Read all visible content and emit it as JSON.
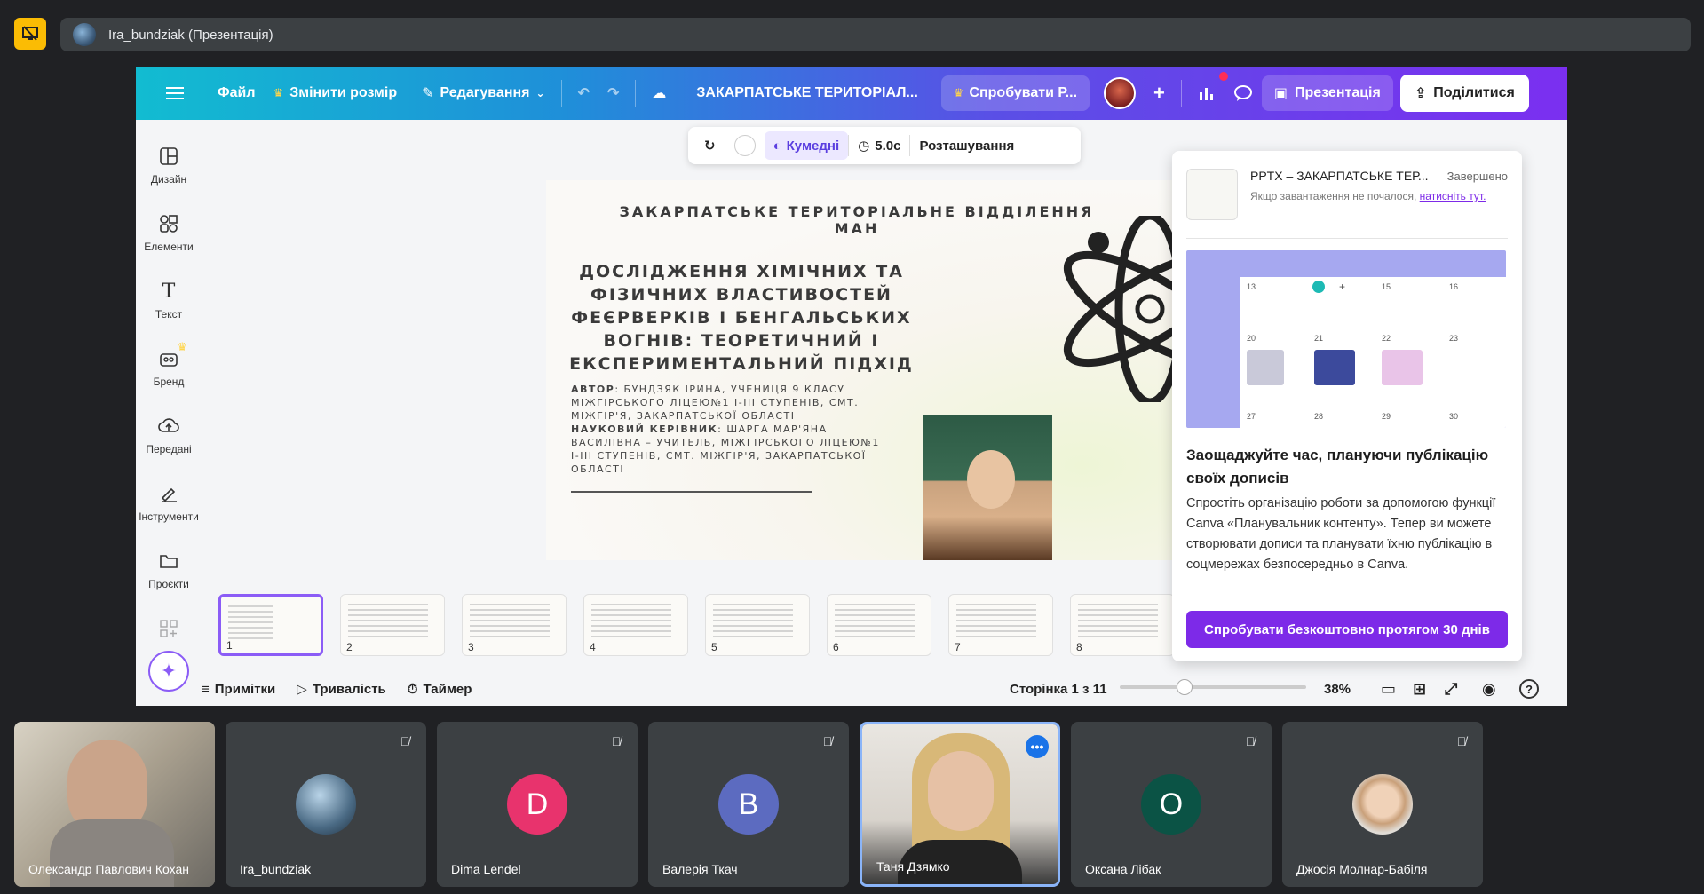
{
  "meet": {
    "presenter_label": "Ira_bundziak (Презентація)"
  },
  "canva": {
    "header": {
      "file": "Файл",
      "resize": "Змінити розмір",
      "editing": "Редагування",
      "doc_title": "ЗАКАРПАТСЬКЕ ТЕРИТОРІАЛ...",
      "try_pro": "Спробувати Р...",
      "present": "Презентація",
      "share": "Поділитися"
    },
    "sidebar": [
      {
        "label": "Дизайн",
        "icon": "design-icon"
      },
      {
        "label": "Елементи",
        "icon": "elements-icon"
      },
      {
        "label": "Текст",
        "icon": "text-icon"
      },
      {
        "label": "Бренд",
        "icon": "brand-icon"
      },
      {
        "label": "Передані",
        "icon": "uploads-icon"
      },
      {
        "label": "Інструменти",
        "icon": "tools-icon"
      },
      {
        "label": "Проєкти",
        "icon": "projects-icon"
      }
    ],
    "floating_toolbar": {
      "style": "Кумедні",
      "duration": "5.0с",
      "position": "Розташування"
    },
    "slide": {
      "header": "ЗАКАРПАТСЬКЕ ТЕРИТОРІАЛЬНЕ ВІДДІЛЕННЯ МАН",
      "title": "ДОСЛІДЖЕННЯ ХІМІЧНИХ ТА ФІЗИЧНИХ ВЛАСТИВОСТЕЙ ФЕЄРВЕРКІВ І БЕНГАЛЬСЬКИХ ВОГНІВ: ТЕОРЕТИЧНИЙ І ЕКСПЕРИМЕНТАЛЬНИЙ ПІДХІД",
      "author_label": "АВТОР",
      "author_text": ": БУНДЗЯК ІРИНА, УЧЕНИЦЯ 9 КЛАСУ МІЖГІРСЬКОГО ЛІЦЕЮ№1 І-ІІІ СТУПЕНІВ, СМТ. МІЖГІР'Я, ЗАКАРПАТСЬКОЇ ОБЛАСТІ",
      "advisor_label": "НАУКОВИЙ КЕРІВНИК",
      "advisor_text": ": ШАРГА МАР'ЯНА ВАСИЛІВНА – УЧИТЕЛЬ, МІЖГІРСЬКОГО ЛІЦЕЮ№1 І-ІІІ СТУПЕНІВ, СМТ. МІЖГІР'Я, ЗАКАРПАТСЬКОЇ ОБЛАСТІ"
    },
    "thumbnails": [
      "1",
      "2",
      "3",
      "4",
      "5",
      "6",
      "7",
      "8"
    ],
    "bottom_bar": {
      "notes": "Примітки",
      "duration": "Тривалість",
      "timer": "Таймер",
      "page": "Сторінка 1 з 11",
      "zoom": "38%",
      "zoom_fraction": 0.38
    },
    "promo": {
      "file_name": "PPTX – ЗАКАРПАТСЬКЕ ТЕР...",
      "status": "Завершено",
      "hint": "Якщо завантаження не почалося,",
      "hint_link": "натисніть тут.",
      "calendar_numbers": [
        "13",
        "15",
        "16",
        "20",
        "21",
        "22",
        "23",
        "27",
        "28",
        "29",
        "30"
      ],
      "title": "Заощаджуйте час, плануючи публікацію своїх дописів",
      "text": "Спростіть організацію роботи за допомогою функції Canva «Планувальник контенту». Тепер ви можете створювати дописи та планувати їхню публікацію в соцмережах безпосередньо в Canva.",
      "cta": "Спробувати безкоштовно протягом 30 днів"
    }
  },
  "participants": [
    {
      "name": "Олександр Павлович Кохан",
      "type": "video",
      "muted": false
    },
    {
      "name": "Ira_bundziak",
      "type": "avatar",
      "muted": true
    },
    {
      "name": "Dima Lendel",
      "type": "letter",
      "letter": "D",
      "color": "#e8336d",
      "muted": true
    },
    {
      "name": "Валерія Ткач",
      "type": "letter",
      "letter": "B",
      "color": "#5c6bc0",
      "muted": true
    },
    {
      "name": "Таня Дзямко",
      "type": "video",
      "muted": false,
      "active": true
    },
    {
      "name": "Оксана Лібак",
      "type": "letter",
      "letter": "O",
      "color": "#0b5345",
      "muted": true
    },
    {
      "name": "Джосія Молнар-Бабіля",
      "type": "avatar",
      "muted": true
    }
  ],
  "colors": {
    "canva_purple": "#7d2ae8",
    "meet_bg": "#202124",
    "tile_bg": "#3c4043"
  }
}
